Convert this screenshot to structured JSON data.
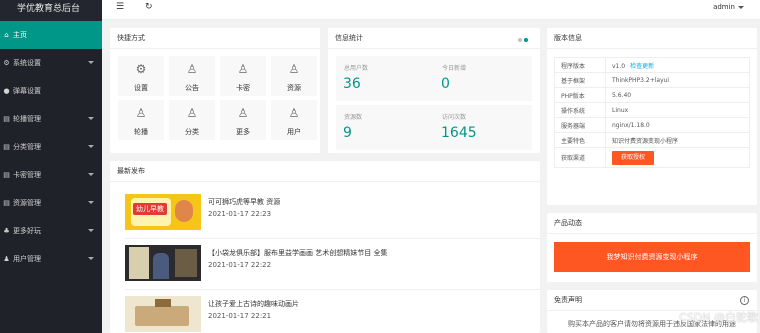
{
  "app": {
    "title": "学优教育总后台"
  },
  "sidebar": {
    "items": [
      {
        "label": "主页",
        "icon": "home-icon",
        "glyph": "⌂",
        "active": true,
        "has_arrow": false
      },
      {
        "label": "系统设置",
        "icon": "gear-icon",
        "glyph": "⚙",
        "active": false,
        "has_arrow": true
      },
      {
        "label": "弹幕设置",
        "icon": "bullet-icon",
        "glyph": "●",
        "active": false,
        "has_arrow": false
      },
      {
        "label": "轮播管理",
        "icon": "slides-icon",
        "glyph": "▤",
        "active": false,
        "has_arrow": true
      },
      {
        "label": "分类管理",
        "icon": "category-icon",
        "glyph": "▤",
        "active": false,
        "has_arrow": true
      },
      {
        "label": "卡密管理",
        "icon": "card-icon",
        "glyph": "▤",
        "active": false,
        "has_arrow": true
      },
      {
        "label": "资源管理",
        "icon": "resource-icon",
        "glyph": "▤",
        "active": false,
        "has_arrow": true
      },
      {
        "label": "更多好玩",
        "icon": "more-icon",
        "glyph": "♣",
        "active": false,
        "has_arrow": true
      },
      {
        "label": "用户管理",
        "icon": "user-icon",
        "glyph": "♟",
        "active": false,
        "has_arrow": true
      }
    ]
  },
  "topbar": {
    "menu_icon": "menu-icon",
    "refresh_icon": "refresh-icon",
    "username": "admin"
  },
  "shortcuts": {
    "title": "快捷方式",
    "items": [
      {
        "label": "设置",
        "icon": "gear-icon",
        "glyph": "⚙"
      },
      {
        "label": "公告",
        "icon": "person-icon",
        "glyph": "♙"
      },
      {
        "label": "卡密",
        "icon": "person-icon",
        "glyph": "♙"
      },
      {
        "label": "资源",
        "icon": "person-icon",
        "glyph": "♙"
      },
      {
        "label": "轮播",
        "icon": "person-icon",
        "glyph": "♙"
      },
      {
        "label": "分类",
        "icon": "person-icon",
        "glyph": "♙"
      },
      {
        "label": "更多",
        "icon": "person-icon",
        "glyph": "♙"
      },
      {
        "label": "用户",
        "icon": "person-icon",
        "glyph": "♙"
      }
    ]
  },
  "stats": {
    "title": "信息统计",
    "items": [
      {
        "label": "总用户数",
        "value": "36"
      },
      {
        "label": "今日新增",
        "value": "0"
      },
      {
        "label": "资源数",
        "value": "9"
      },
      {
        "label": "访问次数",
        "value": "1645"
      }
    ]
  },
  "latest": {
    "title": "最新发布",
    "posts": [
      {
        "title": "可可狮巧虎等早教 资源",
        "date": "2021-01-17 22:23",
        "thumb_caption": "幼儿早教"
      },
      {
        "title": "【小袋龙俱乐部】服布里益学画画 艺术创想精妹节目 全集",
        "date": "2021-01-17 22:22",
        "thumb_caption": ""
      },
      {
        "title": "让孩子爱上古诗的趣味动画片",
        "date": "2021-01-17 22:21",
        "thumb_caption": ""
      }
    ]
  },
  "version": {
    "title": "版本信息",
    "rows": [
      {
        "key": "程序版本",
        "value": "v1.0",
        "link": "检查更新"
      },
      {
        "key": "基于框架",
        "value": "ThinkPHP3.2+layui"
      },
      {
        "key": "PHP版本",
        "value": "5.6.40"
      },
      {
        "key": "操作系统",
        "value": "Linux"
      },
      {
        "key": "服务器端",
        "value": "nginx/1.18.0"
      },
      {
        "key": "主要特色",
        "value": "知识付费资源变现小程序"
      },
      {
        "key": "获取渠道",
        "button": "获取授权"
      }
    ]
  },
  "product": {
    "title": "产品动态",
    "button": "我梦知识付费资源变现小程序"
  },
  "disclaimer": {
    "title": "免责声明",
    "text": "购买本产品的客户请勿将资源用于违反国家法律的用途"
  },
  "watermark": "CSDN @白驼歌"
}
